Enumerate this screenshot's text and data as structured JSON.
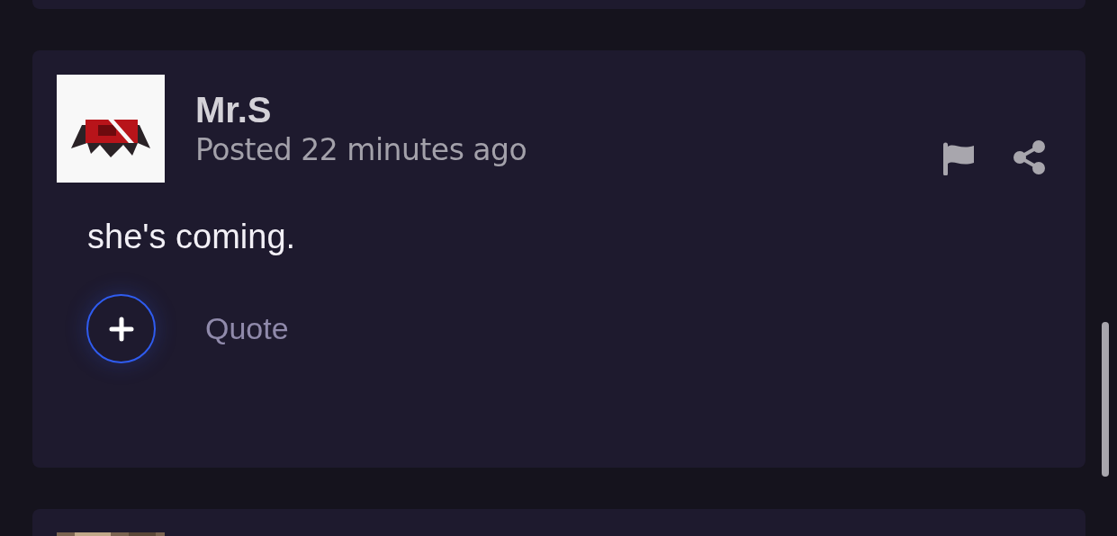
{
  "post": {
    "author": "Mr.S",
    "posted": "Posted 22 minutes ago",
    "body": "she's coming.",
    "quote_label": "Quote"
  }
}
